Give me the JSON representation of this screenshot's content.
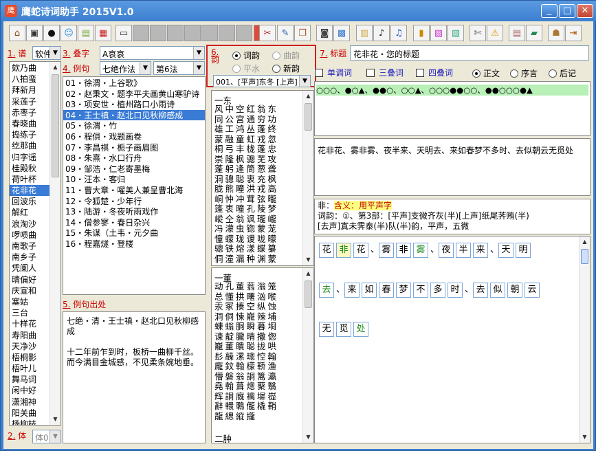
{
  "window": {
    "title": "鹰蛇诗词助手 2015V1.0",
    "icon": "app-icon",
    "min": "_",
    "max": "□",
    "close": "✕"
  },
  "toolbar": {
    "icons": [
      "home-icon",
      "image-icon",
      "penguin-icon",
      "smiley-icon",
      "book-stack-icon",
      "grid-color-icon",
      "document-icon",
      "blank-icon",
      "blank-icon",
      "blank-icon",
      "blank-icon",
      "blank-icon",
      "blank-icon",
      "blank-icon",
      "delete-icon",
      "scissors-x-icon",
      "brush-icon",
      "copy-icon",
      "camera-icon",
      "photo-icon",
      "notebook-icon",
      "music-note-icon",
      "music-pen-icon",
      "books-icon",
      "pink-card-icon",
      "image-gallery-icon",
      "tools-icon",
      "warning-icon",
      "layout-icon",
      "green-book-icon",
      "user-icon",
      "exit-icon"
    ]
  },
  "labels": {
    "pu": {
      "num": "1.",
      "text": "谱"
    },
    "dieZi": {
      "num": "3.",
      "text": "叠字"
    },
    "liJu": {
      "num": "4.",
      "text": "例句"
    },
    "yun": {
      "num": "6.",
      "text": "韵"
    },
    "biaoTi": {
      "num": "7.",
      "text": "标题"
    },
    "liJuChuChu": {
      "num": "5.",
      "text": "例句出处"
    },
    "ti": {
      "num": "2.",
      "text": "体"
    }
  },
  "selects": {
    "pu": "软件",
    "dieZi": "A哀哀",
    "qiJue": "七绝作法",
    "fa": "第6法",
    "yunBu": "001、[平声]东冬 [上声]",
    "ti": "体0"
  },
  "tunes": [
    "欸乃曲",
    "八拍蛮",
    "拜新月",
    "采莲子",
    "赤枣子",
    "春晓曲",
    "捣练子",
    "纥那曲",
    "归字谣",
    "桂殿秋",
    "荷叶杯",
    "花非花",
    "回波乐",
    "解红",
    "浪淘沙",
    "啰唝曲",
    "南歌子",
    "南乡子",
    "凭阑人",
    "晴偏好",
    "庆宣和",
    "塞姑",
    "三台",
    "十样花",
    "寿阳曲",
    "天净沙",
    "梧桐影",
    "梧叶儿",
    "舞马词",
    "闲中好",
    "潇湘神",
    "阳关曲",
    "杨柳枝"
  ],
  "selectedTune": "花非花",
  "examples": [
    "01・徐渭・上谷歌》",
    "02・赵秉文・题李平夫画黄山寒驴诗",
    "03・项安世・植州路口小雨诗",
    "04・王士禛・赵北口见秋柳感成",
    "05・徐渭・竹",
    "06・程俱・戏题画卷",
    "07・李昌祺・栀子画眉图",
    "08・朱熹・水口行舟",
    "09・邹浩・仁老寄墨梅",
    "10・汪本・客归",
    "11・曹大章・嚁美人兼呈曹北海",
    "12・令狐楚・少年行",
    "13・陆游・冬夜听雨戏作",
    "14・僧参寥・春日杂兴",
    "15・朱谋（土韦・元夕曲",
    "16・程嘉燧・登楼"
  ],
  "selectedExample": "04・王士禛・赵北口见秋柳感成",
  "source": {
    "line1": "七绝・清・王士禛・赵北口见秋柳感成",
    "line2": "十二年前乍到时，板桥一曲柳千丝。",
    "line3": "而今满目金城感，不见柔条婉地垂。"
  },
  "rhymeRadios": {
    "ciYun": "词韵",
    "quYun": "曲韵",
    "pingShui": "平水",
    "xinYun": "新韵"
  },
  "rhymeList1": {
    "head": "一东",
    "rows": [
      "风中空红翁东",
      "同公宫通穷功",
      "雄工鸿丛蓬终",
      "蒙融童虹戎忽",
      "桐弓丰栊蓬忠",
      "崇隆枫骢芜攻",
      "蓬躬逢筒葱聋",
      "洞骢聪衷充枫",
      "胧熊瞳洪戎高",
      "峒忡冲茸弦曨",
      "篷衷曈孔陵梦",
      "嵷仝翁讽瓏巄",
      "冯濛虫锪蒙茏",
      "憧蠓珑谡咙曚",
      "骢铁熔漾蝶纂",
      "侗潼漏种渊蒙"
    ]
  },
  "rhymeList2": {
    "head": "一董",
    "rows": [
      "动孔董蓊滃笼",
      "总懂拱曙汹喉",
      "汞冢揍空纵蚀",
      "洞侗悚巃辣埔",
      "蝀螉胴瞬暮埛",
      "谏靛朧晴撒偬",
      "巃董瞶聪拢哄",
      "髟髞漯璁悾翰",
      "龐鈫翰檬鞒渔",
      "懵磐翁詷篱瀛",
      "堯翰葺熜藂翳",
      "辉詷廐褵墀嵸",
      "辭轘鶤儱橇鞘",
      "龍緦縱攏"
    ],
    "tail": "二肿"
  },
  "title": {
    "value": "花非花・您的标题"
  },
  "checks": {
    "danDiaoCi": "单调词",
    "sanDieYun": "三叠词",
    "siDieYun": "四叠词"
  },
  "styleRadios": {
    "zhengWen": "正文",
    "xuYan": "序言",
    "houJi": "后记"
  },
  "pattern": "○○○、●○▲、●●○、○○▲、○○○●●○○、●●○○○●▲",
  "poem": "花非花、雾非雾、夜半来、天明去、来如春梦不多时、去似朝云无觅处",
  "meaning": {
    "word": "非",
    "label": "含义：用平声字",
    "line1": "词韵：①、第3部：[平声]支微齐灰(半)[上声]纸尾荠贿(半)",
    "line2": "[去声]寘未霁泰(半)队(半)韵，平声，五微"
  },
  "grid": [
    [
      [
        "花",
        ""
      ],
      [
        "非",
        "hi g"
      ],
      [
        "花",
        ""
      ],
      [
        "、",
        "sep"
      ],
      [
        "雾",
        ""
      ],
      [
        "非",
        ""
      ],
      [
        "雾",
        "g"
      ],
      [
        "、",
        "sep"
      ],
      [
        "夜",
        ""
      ],
      [
        "半",
        ""
      ],
      [
        "来",
        ""
      ],
      [
        "、",
        "sep"
      ],
      [
        "天",
        ""
      ],
      [
        "明",
        ""
      ]
    ],
    [
      [
        "去",
        "g"
      ],
      [
        "、",
        "sep"
      ],
      [
        "来",
        ""
      ],
      [
        "如",
        ""
      ],
      [
        "春",
        ""
      ],
      [
        "梦",
        ""
      ],
      [
        "不",
        ""
      ],
      [
        "多",
        ""
      ],
      [
        "时",
        ""
      ],
      [
        "、",
        "sep"
      ],
      [
        "去",
        ""
      ],
      [
        "似",
        ""
      ],
      [
        "朝",
        ""
      ],
      [
        "云",
        ""
      ]
    ],
    [
      [
        "无",
        ""
      ],
      [
        "觅",
        ""
      ],
      [
        "处",
        "g"
      ]
    ]
  ]
}
